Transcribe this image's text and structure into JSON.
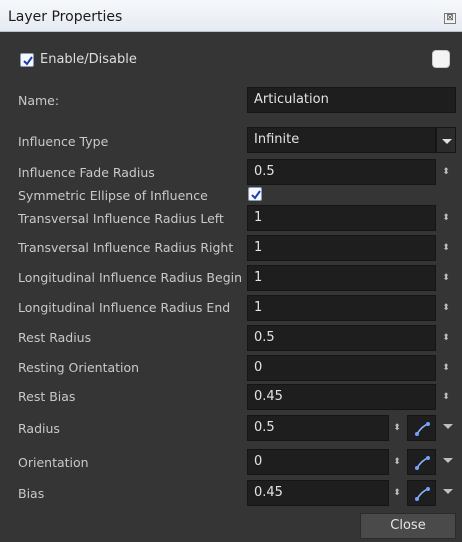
{
  "window": {
    "title": "Layer Properties",
    "close_glyph": "⊠"
  },
  "enable": {
    "label": "Enable/Disable",
    "checked": true
  },
  "name": {
    "label": "Name:",
    "value": "Articulation"
  },
  "influence_type": {
    "label": "Influence Type",
    "value": "Infinite"
  },
  "influence_fade_radius": {
    "label": "Influence Fade Radius",
    "value": "0.5"
  },
  "symmetric_ellipse": {
    "label": "Symmetric Ellipse of Influence",
    "checked": true
  },
  "trans_left": {
    "label": "Transversal Influence Radius Left",
    "value": "1"
  },
  "trans_right": {
    "label": "Transversal Influence Radius Right",
    "value": "1"
  },
  "long_begin": {
    "label": "Longitudinal Influence Radius Begin",
    "value": "1"
  },
  "long_end": {
    "label": "Longitudinal Influence Radius End",
    "value": "1"
  },
  "rest_radius": {
    "label": "Rest Radius",
    "value": "0.5"
  },
  "resting_orientation": {
    "label": "Resting Orientation",
    "value": "0"
  },
  "rest_bias": {
    "label": "Rest Bias",
    "value": "0.45"
  },
  "radius": {
    "label": "Radius",
    "value": "0.5"
  },
  "orientation": {
    "label": "Orientation",
    "value": "0"
  },
  "bias": {
    "label": "Bias",
    "value": "0.45"
  },
  "close_button": {
    "label": "Close"
  },
  "spinner_glyph": "⬍"
}
